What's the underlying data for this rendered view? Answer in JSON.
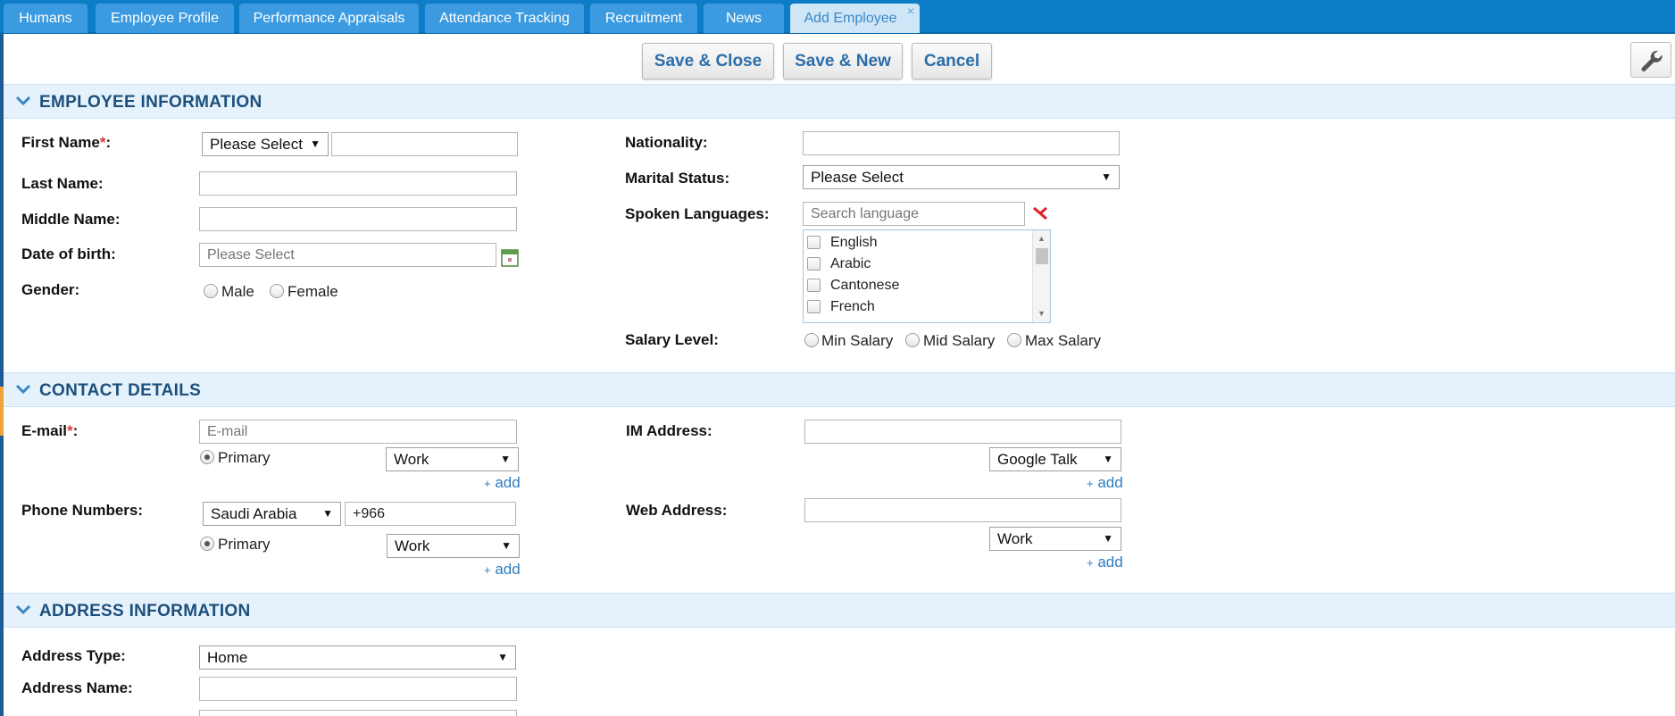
{
  "tabs": [
    {
      "label": "Humans"
    },
    {
      "label": "Employee Profile"
    },
    {
      "label": "Performance Appraisals"
    },
    {
      "label": "Attendance Tracking"
    },
    {
      "label": "Recruitment"
    },
    {
      "label": "News"
    },
    {
      "label": "Add Employee",
      "close": "×"
    }
  ],
  "toolbar": {
    "save_close": "Save & Close",
    "save_new": "Save & New",
    "cancel": "Cancel"
  },
  "sections": {
    "employee": "EMPLOYEE INFORMATION",
    "contact": "CONTACT DETAILS",
    "address": "ADDRESS INFORMATION"
  },
  "employee": {
    "first_name_label": "First Name",
    "required_mark": "*",
    "colon": ":",
    "title_select": "Please Select",
    "last_name_label": "Last Name:",
    "middle_name_label": "Middle Name:",
    "dob_label": "Date of birth:",
    "dob_placeholder": "Please Select",
    "gender_label": "Gender:",
    "gender_male": "Male",
    "gender_female": "Female",
    "nationality_label": "Nationality:",
    "marital_label": "Marital Status:",
    "marital_select": "Please Select",
    "languages_label": "Spoken Languages:",
    "language_search_placeholder": "Search language",
    "languages": [
      "English",
      "Arabic",
      "Cantonese",
      "French"
    ],
    "salary_label": "Salary Level:",
    "salary_min": "Min Salary",
    "salary_mid": "Mid Salary",
    "salary_max": "Max Salary"
  },
  "contact": {
    "email_label": "E-mail",
    "email_placeholder": "E-mail",
    "primary": "Primary",
    "email_type": "Work",
    "add": "add",
    "add_plus": "+",
    "phone_label": "Phone Numbers:",
    "phone_country": "Saudi Arabia",
    "phone_code": "+966",
    "phone_type": "Work",
    "im_label": "IM Address:",
    "im_type": "Google Talk",
    "web_label": "Web Address:",
    "web_type": "Work"
  },
  "address": {
    "type_label": "Address Type:",
    "type_value": "Home",
    "name_label": "Address Name:"
  },
  "colors": {
    "tabbar": "#0d7dc7",
    "tab": "#3c9be0",
    "tab_active": "#cfe6f7",
    "section_bg": "#e5f2fb",
    "section_text": "#1c4f7c",
    "link": "#2d7cc1",
    "required": "#e03030"
  }
}
